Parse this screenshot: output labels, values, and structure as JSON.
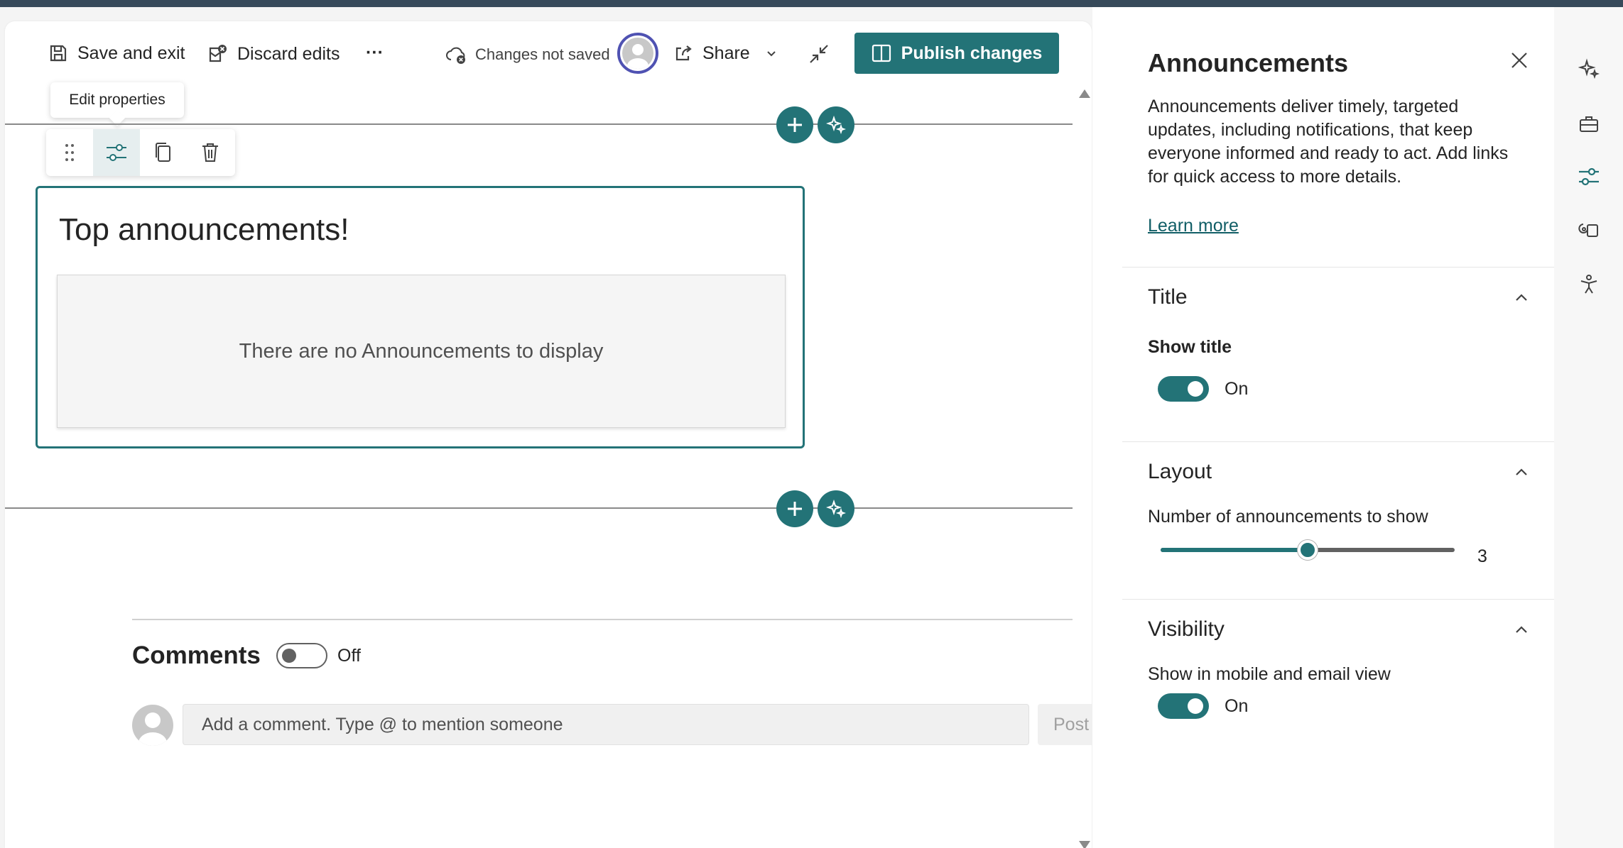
{
  "toolbar": {
    "save_exit": "Save and exit",
    "discard": "Discard edits",
    "more": "···",
    "status": "Changes not saved",
    "share": "Share",
    "publish": "Publish changes"
  },
  "tooltip": "Edit properties",
  "webpart": {
    "title": "Top announcements!",
    "empty_message": "There are no Announcements to display"
  },
  "comments": {
    "title": "Comments",
    "toggle_label": "Off",
    "placeholder": "Add a comment. Type @ to mention someone",
    "post": "Post"
  },
  "panel": {
    "title": "Announcements",
    "description": "Announcements deliver timely, targeted updates, including notifications, that keep everyone informed and ready to act. Add links for quick access to more details.",
    "learn_more": "Learn more",
    "sections": {
      "title": {
        "heading": "Title",
        "show_title_label": "Show title",
        "show_title_state": "On"
      },
      "layout": {
        "heading": "Layout",
        "count_label": "Number of announcements to show",
        "count_value": "3",
        "count_fraction": 0.5
      },
      "visibility": {
        "heading": "Visibility",
        "mobile_label": "Show in mobile and email view",
        "mobile_state": "On"
      }
    }
  },
  "colors": {
    "accent": "#237377",
    "topbar": "#374a5a",
    "avatar_ring": "#4f52b2"
  }
}
